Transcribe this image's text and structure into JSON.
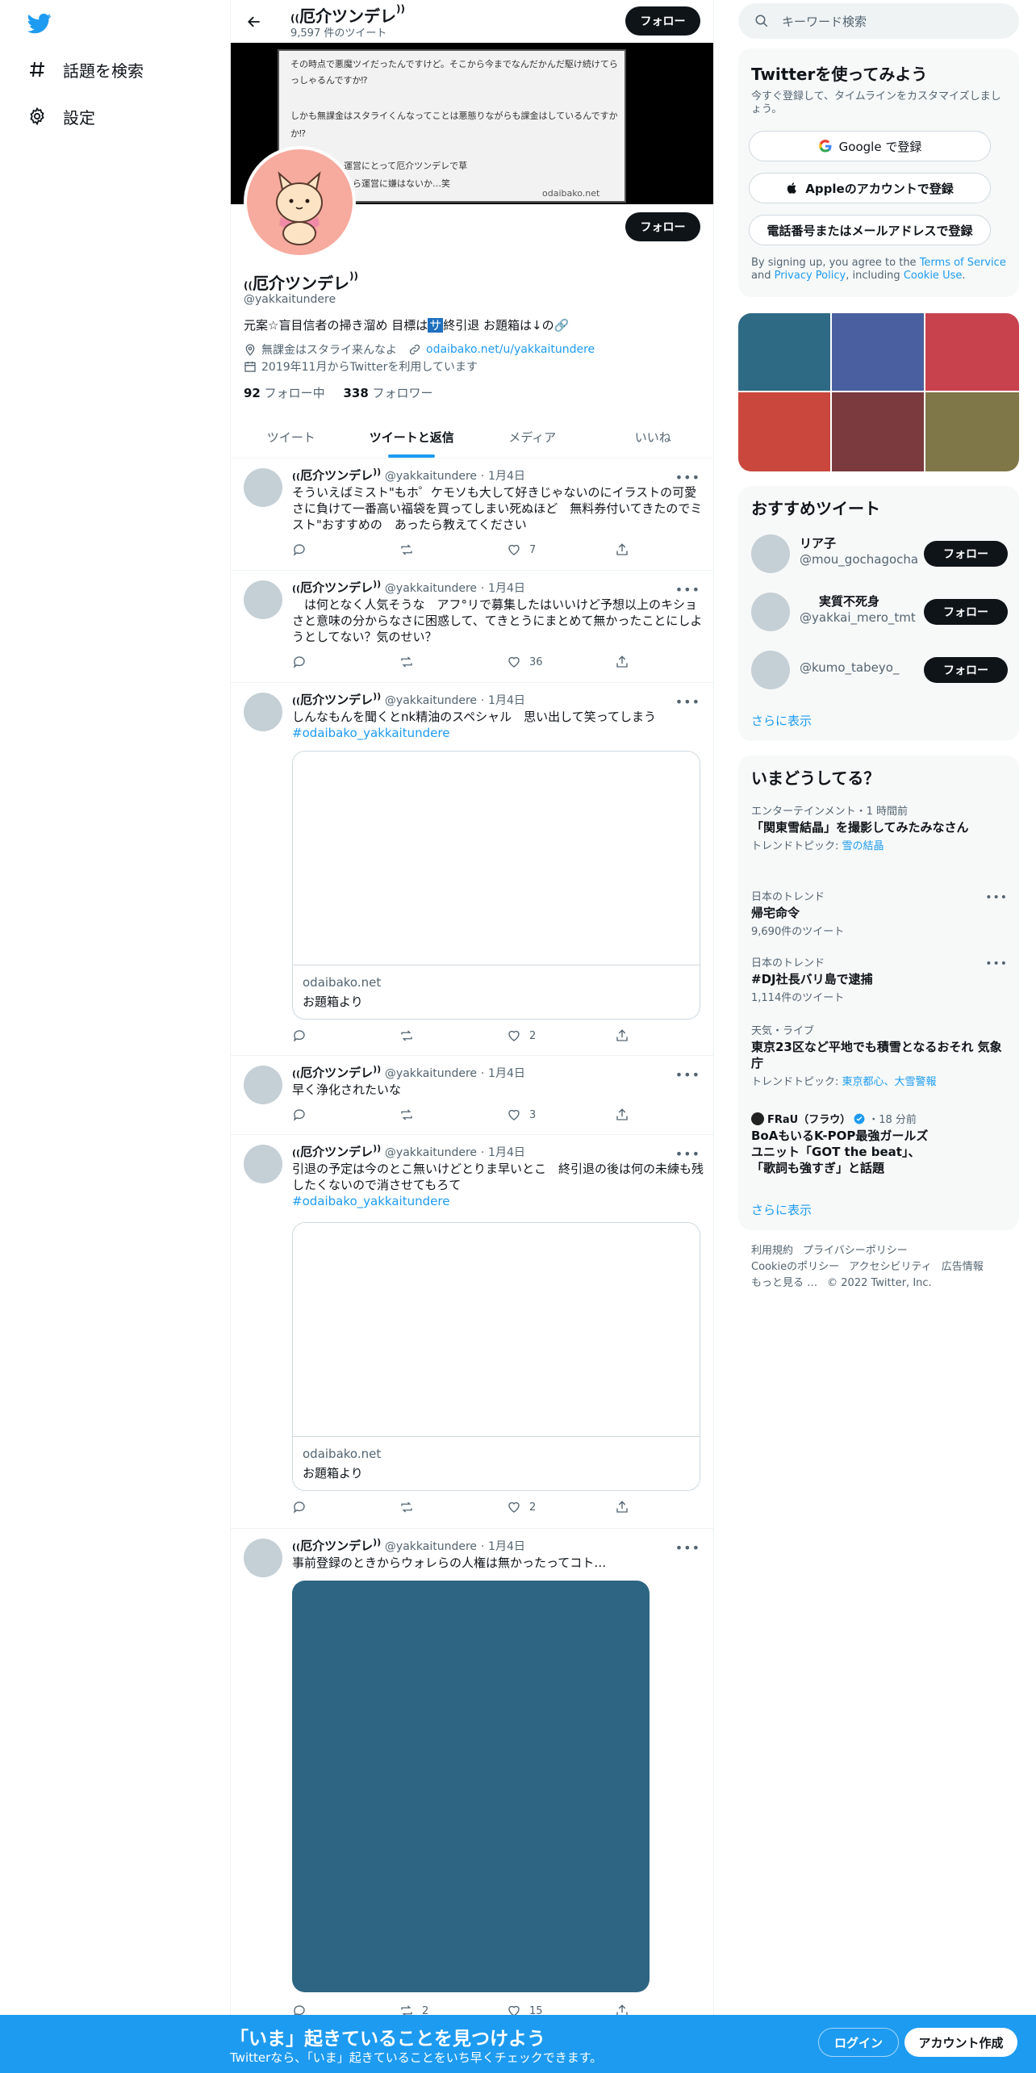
{
  "nav": {
    "logo_icon": "twitter-bird-icon",
    "items": [
      {
        "label": "話題を検索",
        "icon": "hashtag-icon"
      },
      {
        "label": "設定",
        "icon": "gear-icon"
      }
    ]
  },
  "header": {
    "name": "厄介ツンデレ",
    "tweet_count": "9,597 件のツイート",
    "follow_label": "フォロー"
  },
  "banner": {
    "lines": [
      "その時点で悪魔ツイだったんですけど。そこから今までなんだかんだ駆け続けてら",
      "っしゃるんですか⁉",
      "しかも無課金はスタライくんなってことは悪態りながらも課金はしているんですか",
      "か⁉",
      "運営にとって厄介ツンデレで草",
      "から運営に嫌はないか…笑"
    ],
    "watermark": "odaibako.net"
  },
  "profile": {
    "name": "厄介ツンデレ",
    "handle": "@yakkaitundere",
    "bio_before": "元案☆盲目信者の掃き溜め 目標は",
    "bio_badge": "サ",
    "bio_after": "終引退 お題箱は↓の🔗",
    "location": "無課金はスタライ来んなよ",
    "url": "odaibako.net/u/yakkaitundere",
    "joined": "2019年11月からTwitterを利用しています",
    "following_count": "92",
    "following_label": "フォロー中",
    "followers_count": "338",
    "followers_label": "フォロワー",
    "follow_label": "フォロー"
  },
  "tabs": [
    {
      "label": "ツイート",
      "active": false
    },
    {
      "label": "ツイートと返信",
      "active": true
    },
    {
      "label": "メディア",
      "active": false
    },
    {
      "label": "いいね",
      "active": false
    }
  ],
  "tweets": [
    {
      "name": "厄介ツンデレ",
      "handle": "@yakkaitundere",
      "date": "1月4日",
      "text": "そういえばミスト\"もホ゜ケモソも大して好きじゃないのにイラストの可愛さに負けて一番高い福袋を買ってしまい死ぬほど　無料券付いてきたのでミスト\"おすすめの　あったら教えてください",
      "replies": "",
      "retweets": "",
      "likes": "7"
    },
    {
      "name": "厄介ツンデレ",
      "handle": "@yakkaitundere",
      "date": "1月4日",
      "text": "　は何となく人気そうな　アフ°リで募集したはいいけど予想以上のキショさと意味の分からなさに困惑して、てきとうにまとめて無かったことにしようとしてない？気のせい？",
      "replies": "",
      "retweets": "",
      "likes": "36"
    },
    {
      "name": "厄介ツンデレ",
      "handle": "@yakkaitundere",
      "date": "1月4日",
      "text": "しんなもんを聞くとnk精油のスペシャル　思い出して笑ってしまう",
      "hashtag": "#odaibako_yakkaitundere",
      "card_domain": "odaibako.net",
      "card_title": "お題箱より",
      "replies": "",
      "retweets": "",
      "likes": "2"
    },
    {
      "name": "厄介ツンデレ",
      "handle": "@yakkaitundere",
      "date": "1月4日",
      "text": "早く浄化されたいな",
      "replies": "",
      "retweets": "",
      "likes": "3"
    },
    {
      "name": "厄介ツンデレ",
      "handle": "@yakkaitundere",
      "date": "1月4日",
      "text": "引退の予定は今のとこ無いけどとりま早いとこ　終引退の後は何の未練も残したくないので消させてもろて",
      "hashtag": "#odaibako_yakkaitundere",
      "card_domain": "odaibako.net",
      "card_title": "お題箱より",
      "replies": "",
      "retweets": "",
      "likes": "2"
    },
    {
      "name": "厄介ツンデレ",
      "handle": "@yakkaitundere",
      "date": "1月4日",
      "text": "事前登録のときからウォレらの人権は無かったってコト…",
      "replies": "",
      "retweets": "2",
      "likes": "15"
    }
  ],
  "right": {
    "search_placeholder": "キーワード検索",
    "signup": {
      "title": "Twitterを使ってみよう",
      "subtitle": "今すぐ登録して、タイムラインをカスタマイズしましょう。",
      "google": "Google で登録",
      "apple": "Appleのアカウントで登録",
      "phone": "電話番号またはメールアドレスで登録",
      "terms_pre": "By signing up, you agree to the ",
      "terms_link": "Terms of Service",
      "terms_mid": " and ",
      "privacy_link": "Privacy Policy",
      "terms_mid2": ", including ",
      "cookie_link": "Cookie Use",
      "terms_end": "."
    },
    "media_colors": [
      "#2f6a85",
      "#4a5fa0",
      "#c8424e",
      "#c9473d",
      "#7a3a3e",
      "#807748"
    ],
    "recommend": {
      "title": "おすすめツイート",
      "users": [
        {
          "name": "リア子",
          "handle": "@mou_gochagocha"
        },
        {
          "name": "実質不死身",
          "handle": "@yakkai_mero_tmt"
        },
        {
          "name": "",
          "handle": "@kumo_tabeyo_"
        }
      ],
      "follow_label": "フォロー",
      "more": "さらに表示"
    },
    "trends": {
      "title": "いまどうしてる？",
      "items": [
        {
          "meta": "エンターテインメント・1 時間前",
          "title": "「関東雪結晶」を撮影してみたみなさん",
          "sub_label": "トレンドトピック: ",
          "sub_link": "雪の結晶"
        },
        {
          "meta": "日本のトレンド",
          "title": "帰宅命令",
          "sub_label": "9,690件のツイート",
          "sub_link": ""
        },
        {
          "meta": "日本のトレンド",
          "title": "#DJ社長バリ島で逮捕",
          "sub_label": "1,114件のツイート",
          "sub_link": ""
        },
        {
          "meta": "天気・ライブ",
          "title": "東京23区など平地でも積雪となるおそれ 気象庁",
          "sub_label": "トレンドトピック: ",
          "sub_link": "東京都心、大雪警報"
        },
        {
          "meta_source": "FRaU（フラウ）",
          "meta_time": "・18 分前",
          "title": "BoAもいるK-POP最強ガールズユニット「GOT the beat」、「歌詞も強すぎ」と話題"
        }
      ],
      "more": "さらに表示"
    },
    "footer": {
      "links": [
        "利用規約",
        "プライバシーポリシー",
        "Cookieのポリシー",
        "アクセシビリティ",
        "広告情報",
        "もっと見る …"
      ],
      "copyright": "© 2022 Twitter, Inc."
    }
  },
  "bottom_bar": {
    "title": "「いま」起きていることを見つけよう",
    "subtitle": "Twitterなら、「いま」起きていることをいち早くチェックできます。",
    "login": "ログイン",
    "signup": "アカウント作成"
  }
}
